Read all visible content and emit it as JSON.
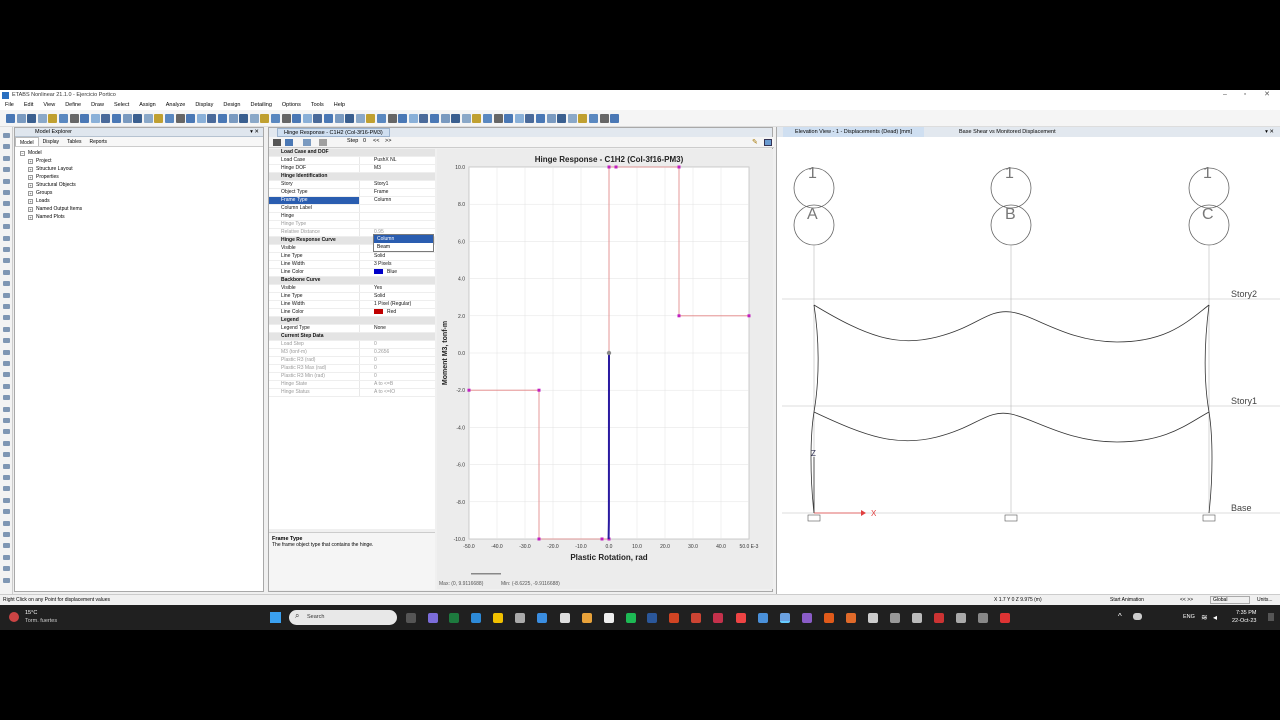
{
  "window": {
    "title": "ETABS Nonlinear 21.1.0 - Ejercicio Portico",
    "min": "–",
    "max": "▫",
    "close": "✕"
  },
  "menu": [
    "File",
    "Edit",
    "View",
    "Define",
    "Draw",
    "Select",
    "Assign",
    "Analyze",
    "Display",
    "Design",
    "Detailing",
    "Options",
    "Tools",
    "Help"
  ],
  "explorer": {
    "title": "Model Explorer",
    "close": "▾ ✕",
    "tabs": [
      "Model",
      "Display",
      "Tables",
      "Reports"
    ],
    "root": "Model",
    "items": [
      "Project",
      "Structure Layout",
      "Properties",
      "Structural Objects",
      "Groups",
      "Loads",
      "Named Output Items",
      "Named Plots"
    ]
  },
  "hinge": {
    "tab": "Hinge Response - C1H2 (Col-3f16-PM3)",
    "step_label": "Step",
    "step_value": "0",
    "nav_prev": "<<",
    "nav_next": ">>",
    "sections": {
      "s1": "Load Case and DOF",
      "s2": "Hinge Identification",
      "s3": "Hinge Response Curve",
      "s4": "Backbone Curve",
      "s5": "Legend",
      "s6": "Current Step Data"
    },
    "rows": {
      "load_case_k": "Load Case",
      "load_case_v": "PushX NL",
      "hinge_dof_k": "Hinge DOF",
      "hinge_dof_v": "M3",
      "story_k": "Story",
      "story_v": "Story1",
      "object_type_k": "Object Type",
      "object_type_v": "Frame",
      "frame_type_k": "Frame Type",
      "frame_type_v": "Column",
      "column_label_k": "Column Label",
      "hinge_k": "Hinge",
      "hinge_type_k": "Hinge Type",
      "rel_dist_k": "Relative Distance",
      "rel_dist_v": "0.95",
      "visible_k": "Visible",
      "visible_v": "Yes",
      "line_type_k": "Line Type",
      "line_type_v": "Solid",
      "line_width_k": "Line Width",
      "line_width_v": "3 Pixels",
      "line_color_k": "Line Color",
      "line_color_v": "Blue",
      "bb_visible_k": "Visible",
      "bb_visible_v": "Yes",
      "bb_line_type_k": "Line Type",
      "bb_line_type_v": "Solid",
      "bb_line_width_k": "Line Width",
      "bb_line_width_v": "1 Pixel (Regular)",
      "bb_line_color_k": "Line Color",
      "bb_line_color_v": "Red",
      "legend_type_k": "Legend Type",
      "legend_type_v": "None",
      "load_step_k": "Load Step",
      "load_step_v": "0",
      "m3_k": "M3 (tonf-m)",
      "m3_v": "0.2656",
      "pr3_k": "Plastic R3 (rad)",
      "pr3_v": "0",
      "pr3max_k": "Plastic R3 Max (rad)",
      "pr3max_v": "0",
      "pr3min_k": "Plastic R3 Min (rad)",
      "pr3min_v": "0",
      "hstate_k": "Hinge State",
      "hstate_v": "A to <=B",
      "hstatus_k": "Hinge Status",
      "hstatus_v": "A to <=IO"
    },
    "dropdown_options": [
      "Column",
      "Beam"
    ],
    "desc_title": "Frame Type",
    "desc_text": "The frame object type that contains the hinge.",
    "colors": {
      "blue": "#0000c8",
      "red": "#c00000"
    }
  },
  "chart_data": {
    "type": "line",
    "title": "Hinge Response - C1H2 (Col-3f16-PM3)",
    "xlabel": "Plastic Rotation, rad",
    "ylabel": "Moment M3, tonf-m",
    "xlim": [
      -0.05,
      0.05
    ],
    "ylim": [
      -10,
      10
    ],
    "xticks": [
      "-50.0",
      "-40.0",
      "-30.0",
      "-20.0",
      "-10.0",
      "0.0",
      "10.0",
      "20.0",
      "30.0",
      "40.0",
      "50.0 E-3"
    ],
    "yticks": [
      "10.0",
      "8.0",
      "6.0",
      "4.0",
      "2.0",
      "0.0",
      "-2.0",
      "-4.0",
      "-6.0",
      "-8.0",
      "-10.0"
    ],
    "series": [
      {
        "color": "#e08080",
        "x": [
          -0.05,
          -0.025,
          -0.025,
          -0.0025,
          -0.0025,
          0,
          0,
          0.0025,
          0.0025,
          0.025,
          0.025,
          0.05
        ],
        "y": [
          -2,
          -2,
          -10,
          -10,
          -10,
          -10,
          10,
          10,
          10,
          10,
          2,
          2
        ]
      },
      {
        "color": "#2a1aa0",
        "x": [
          -0.00015,
          -5e-05,
          0,
          0.0001
        ],
        "y": [
          -10,
          -9,
          0,
          0
        ]
      }
    ],
    "grid": true,
    "footer_max": "Max: (0, 9.9116688)",
    "footer_min": "Min: (-8.6225, -9.9116688)"
  },
  "elevation": {
    "tabs": [
      "Elevation View - 1 - Displacements (Dead)  [mm]",
      "Base Shear vs Monitored Displacement"
    ],
    "grid_top": [
      "1",
      "1",
      "1"
    ],
    "grid_letters": [
      "A",
      "B",
      "C"
    ],
    "stories": [
      "Story2",
      "Story1",
      "Base"
    ],
    "axis_z": "Z",
    "axis_x": "X"
  },
  "status": {
    "left": "Right Click on any Point for displacement values",
    "coords": "X 1.7  Y 0  Z 9.975 (m)",
    "start_animation": "Start Animation",
    "nav": "<<   >>",
    "global": "Global",
    "units": "Units..."
  },
  "taskbar": {
    "weather_temp": "15°C",
    "weather_desc": "Torm. fuertes",
    "search": "Search",
    "lang": "ENG",
    "time": "7:35 PM",
    "date": "22-Oct-23"
  }
}
